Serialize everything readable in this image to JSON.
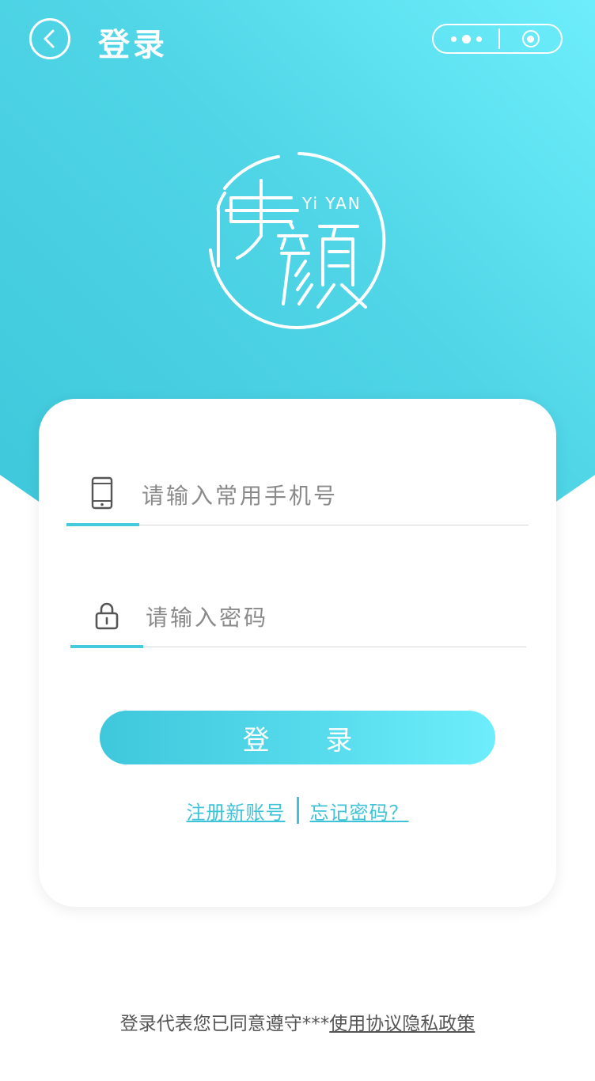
{
  "header": {
    "title": "登录"
  },
  "logo": {
    "text_cn": "伊颜",
    "text_en": "Yi YAN"
  },
  "form": {
    "phone_placeholder": "请输入常用手机号",
    "password_placeholder": "请输入密码",
    "login_button": "登 录",
    "register_link": "注册新账号",
    "forgot_link": "忘记密码？"
  },
  "footer": {
    "agreement_prefix": "登录代表您已同意遵守***",
    "agreement_link": "使用协议隐私政策"
  },
  "colors": {
    "accent": "#46cadd",
    "gradient_light": "#6eeefc",
    "gradient_dark": "#3ec7db"
  },
  "icons": [
    "back-icon",
    "more-dots-icon",
    "close-target-icon",
    "phone-icon",
    "lock-icon"
  ]
}
